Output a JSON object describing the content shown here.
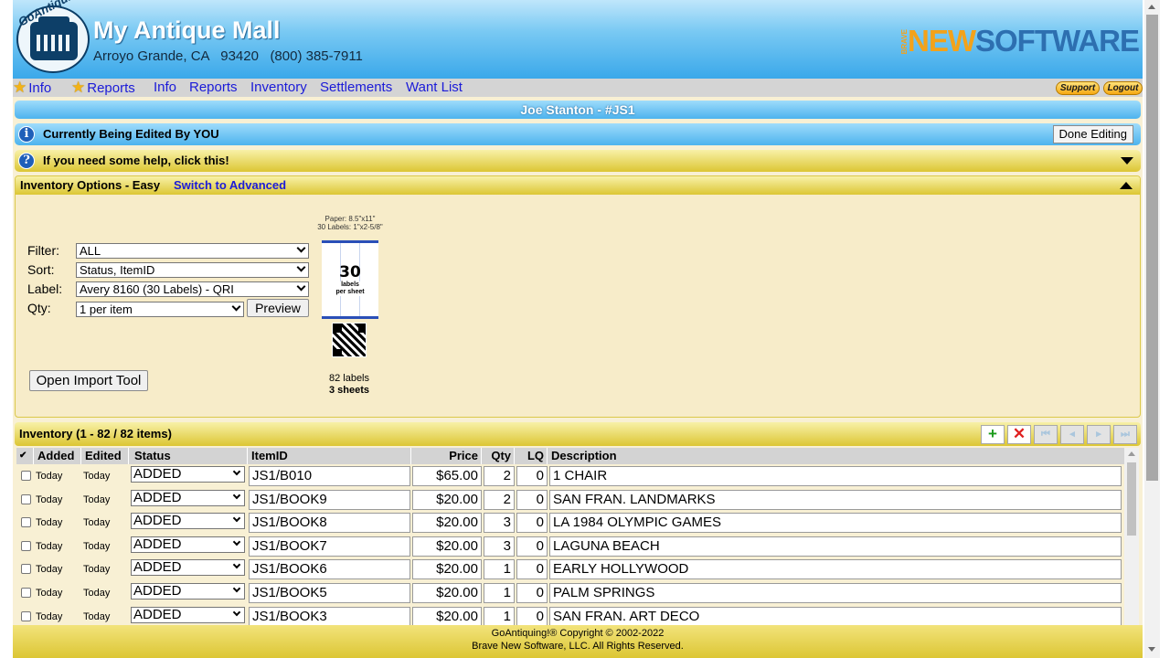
{
  "header": {
    "logo_text": "GoAntiquing!",
    "mall_name": "My Antique Mall",
    "address": "Arroyo Grande, CA   93420   (800) 385-7911",
    "brand_prefix": "BRAVE",
    "brand_new": "NEW",
    "brand_software": "SOFTWARE"
  },
  "nav": {
    "items": [
      "Info",
      "Reports",
      "Info",
      "Reports",
      "Inventory",
      "Settlements",
      "Want List"
    ],
    "support": "Support",
    "logout": "Logout"
  },
  "vendor_title": "Joe Stanton - #JS1",
  "edit_bar": {
    "icon": "i",
    "text": "Currently Being Edited By YOU",
    "done_button": "Done Editing"
  },
  "help_bar": {
    "icon": "?",
    "text": "If you need some help, click this!"
  },
  "options": {
    "title": "Inventory Options - Easy",
    "switch_link": "Switch to Advanced",
    "filter_label": "Filter:",
    "filter_value": "ALL",
    "sort_label": "Sort:",
    "sort_value": "Status, ItemID",
    "label_label": "Label:",
    "label_value": "Avery 8160 (30 Labels) - QRI",
    "qty_label": "Qty:",
    "qty_value": "1 per item",
    "preview_button": "Preview",
    "import_button": "Open Import Tool",
    "paper_line1": "Paper: 8.5\"x11\"",
    "paper_line2": "30 Labels: 1\"x2-5/8\"",
    "sheet_count": "30",
    "sheet_sub1": "labels",
    "sheet_sub2": "per sheet",
    "labels_count": "82 labels",
    "sheets_count": "3 sheets"
  },
  "inventory": {
    "title": "Inventory (1 - 82 / 82 items)",
    "toolbar": {
      "add": "+",
      "delete": "✕",
      "first": "⏮",
      "prev": "◂",
      "next": "▸",
      "last": "⏭"
    },
    "columns": {
      "check": "✔",
      "added": "Added",
      "edited": "Edited",
      "status": "Status",
      "item_id": "ItemID",
      "price": "Price",
      "qty": "Qty",
      "lq": "LQ",
      "description": "Description"
    },
    "rows": [
      {
        "added": "Today",
        "edited": "Today",
        "status": "ADDED",
        "item_id": "JS1/B010",
        "price": "$65.00",
        "qty": "2",
        "lq": "0",
        "description": "1 CHAIR"
      },
      {
        "added": "Today",
        "edited": "Today",
        "status": "ADDED",
        "item_id": "JS1/BOOK9",
        "price": "$20.00",
        "qty": "2",
        "lq": "0",
        "description": "SAN FRAN. LANDMARKS"
      },
      {
        "added": "Today",
        "edited": "Today",
        "status": "ADDED",
        "item_id": "JS1/BOOK8",
        "price": "$20.00",
        "qty": "3",
        "lq": "0",
        "description": "LA 1984 OLYMPIC GAMES"
      },
      {
        "added": "Today",
        "edited": "Today",
        "status": "ADDED",
        "item_id": "JS1/BOOK7",
        "price": "$20.00",
        "qty": "3",
        "lq": "0",
        "description": "LAGUNA BEACH"
      },
      {
        "added": "Today",
        "edited": "Today",
        "status": "ADDED",
        "item_id": "JS1/BOOK6",
        "price": "$20.00",
        "qty": "1",
        "lq": "0",
        "description": "EARLY HOLLYWOOD"
      },
      {
        "added": "Today",
        "edited": "Today",
        "status": "ADDED",
        "item_id": "JS1/BOOK5",
        "price": "$20.00",
        "qty": "1",
        "lq": "0",
        "description": "PALM SPRINGS"
      },
      {
        "added": "Today",
        "edited": "Today",
        "status": "ADDED",
        "item_id": "JS1/BOOK3",
        "price": "$20.00",
        "qty": "1",
        "lq": "0",
        "description": "SAN FRAN. ART DECO"
      }
    ]
  },
  "footer": {
    "line1": "GoAntiquing!® Copyright © 2002-2022",
    "line2": "Brave New Software, LLC. All Rights Reserved."
  }
}
